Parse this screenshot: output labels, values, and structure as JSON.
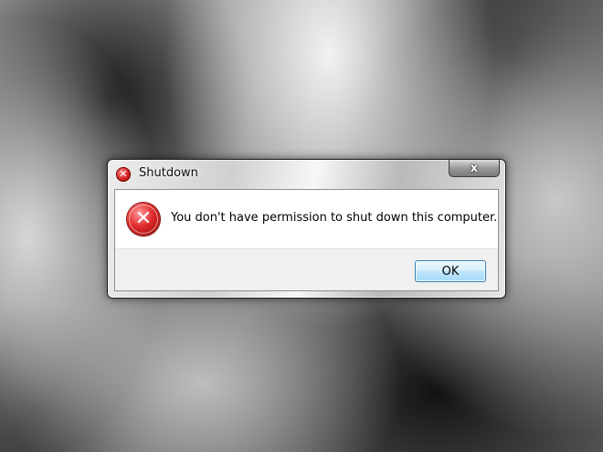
{
  "dialog": {
    "title": "Shutdown",
    "title_icon": "error-icon",
    "close_glyph": "x",
    "message": "You don't have permission to shut down this computer.",
    "message_icon": "error-icon",
    "error_glyph": "✕",
    "ok_label": "OK"
  },
  "colors": {
    "error_red": "#d42020",
    "button_border": "#3c7fb1",
    "button_fill": "#bee6fd"
  }
}
